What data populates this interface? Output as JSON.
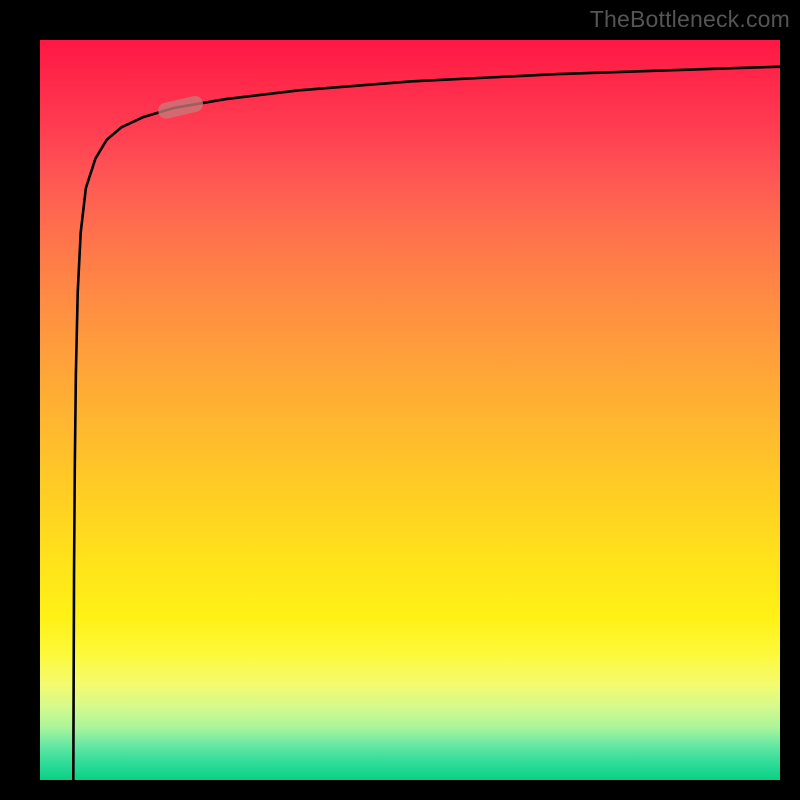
{
  "attribution": "TheBottleneck.com",
  "chart_data": {
    "type": "line",
    "title": "",
    "xlabel": "",
    "ylabel": "",
    "xlim": [
      0,
      100
    ],
    "ylim": [
      0,
      100
    ],
    "series": [
      {
        "name": "curve",
        "x": [
          4.5,
          4.55,
          4.6,
          4.7,
          4.85,
          5.1,
          5.5,
          6.2,
          7.5,
          9.0,
          11.0,
          14.0,
          18.0,
          25.0,
          35.0,
          50.0,
          70.0,
          100.0
        ],
        "y": [
          0,
          14,
          28,
          42,
          55,
          66,
          74,
          80,
          84,
          86.5,
          88.2,
          89.6,
          90.8,
          92.0,
          93.2,
          94.4,
          95.4,
          96.4
        ]
      }
    ],
    "marker": {
      "band_x": [
        16,
        22
      ],
      "band_y": [
        90.2,
        91.6
      ]
    },
    "gradient_stops": [
      {
        "pos": 0,
        "color": "#ff1744"
      },
      {
        "pos": 50,
        "color": "#ffad34"
      },
      {
        "pos": 80,
        "color": "#fff116"
      },
      {
        "pos": 100,
        "color": "#0bd085"
      }
    ]
  }
}
